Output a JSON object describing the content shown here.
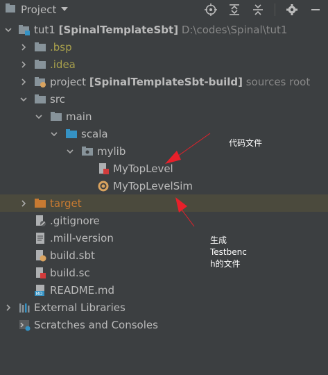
{
  "header": {
    "title": "Project",
    "icons": [
      "dropdown-icon",
      "locate-icon",
      "expand-all-icon",
      "collapse-all-icon",
      "settings-icon",
      "minimize-icon"
    ]
  },
  "tree": {
    "root": {
      "name": "tut1",
      "module": "[SpinalTemplateSbt]",
      "path": "D:\\codes\\Spinal\\tut1"
    },
    "bsp": ".bsp",
    "idea": ".idea",
    "project": {
      "name": "project",
      "module": "[SpinalTemplateSbt-build]",
      "note": "sources root"
    },
    "src": "src",
    "main": "main",
    "scala": "scala",
    "mylib": "mylib",
    "mytoplevel": "MyTopLevel",
    "mytoplevelsim": "MyTopLevelSim",
    "target": "target",
    "gitignore": ".gitignore",
    "millversion": ".mill-version",
    "buildsbt": "build.sbt",
    "buildsc": "build.sc",
    "readme": "README.md",
    "external": "External Libraries",
    "scratches": "Scratches and Consoles"
  },
  "annotations": {
    "code_file": "代码文件",
    "testbench_line1": "生成",
    "testbench_line2": "Testbenc",
    "testbench_line3": "h的文件",
    "arrow_color": "#e8202a"
  },
  "colors": {
    "background": "#3c3f41",
    "selected_row": "#4b4a3d",
    "folder": "#87939a",
    "source_folder": "#3592c4",
    "excluded_folder": "#c77a32"
  }
}
